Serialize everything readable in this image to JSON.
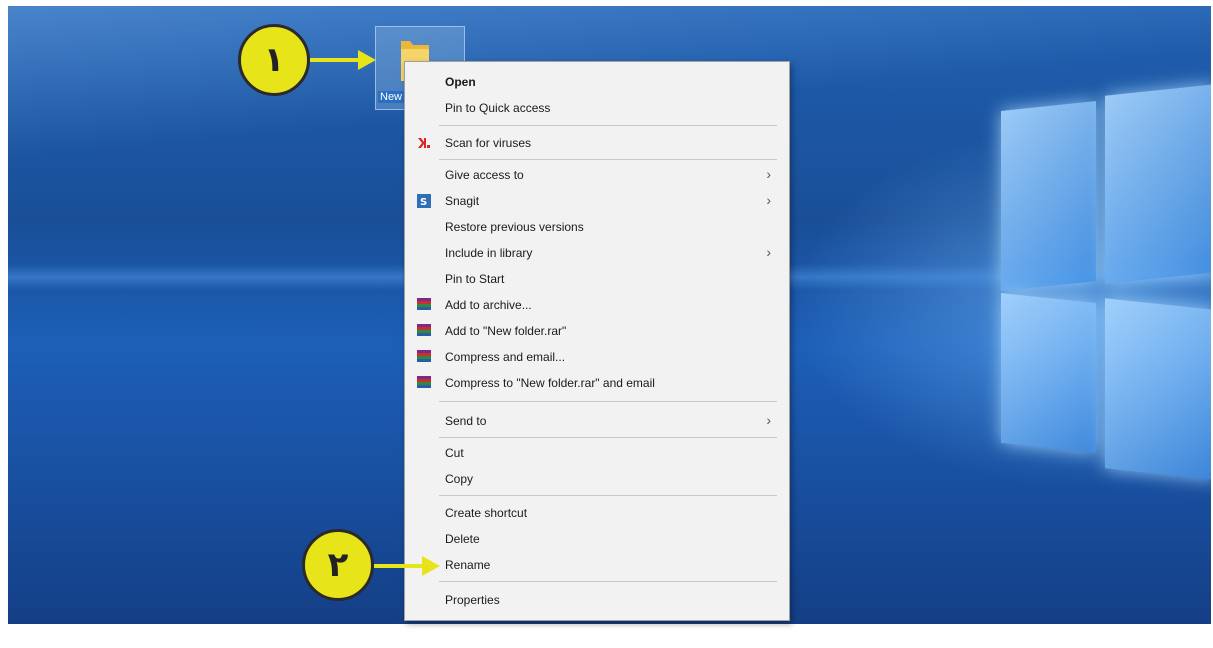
{
  "desktop": {
    "folder_label": "New folder"
  },
  "context_menu": {
    "items": [
      {
        "label": "Open",
        "bold": true
      },
      {
        "label": "Pin to Quick access"
      },
      {
        "label": "Scan for viruses",
        "icon": "antivirus-icon"
      },
      {
        "label": "Give access to",
        "submenu": true
      },
      {
        "label": "Snagit",
        "icon": "snagit-icon",
        "submenu": true
      },
      {
        "label": "Restore previous versions"
      },
      {
        "label": "Include in library",
        "submenu": true
      },
      {
        "label": "Pin to Start"
      },
      {
        "label": "Add to archive...",
        "icon": "winrar-icon"
      },
      {
        "label": "Add to \"New folder.rar\"",
        "icon": "winrar-icon"
      },
      {
        "label": "Compress and email...",
        "icon": "winrar-icon"
      },
      {
        "label": "Compress to \"New folder.rar\" and email",
        "icon": "winrar-icon"
      },
      {
        "label": "Send to",
        "submenu": true
      },
      {
        "label": "Cut"
      },
      {
        "label": "Copy"
      },
      {
        "label": "Create shortcut"
      },
      {
        "label": "Delete"
      },
      {
        "label": "Rename"
      },
      {
        "label": "Properties"
      }
    ]
  },
  "callouts": [
    {
      "number": "١"
    },
    {
      "number": "٢"
    }
  ],
  "colors": {
    "callout": "#e8e41a",
    "desktop_blue": "#1d5fb8"
  }
}
